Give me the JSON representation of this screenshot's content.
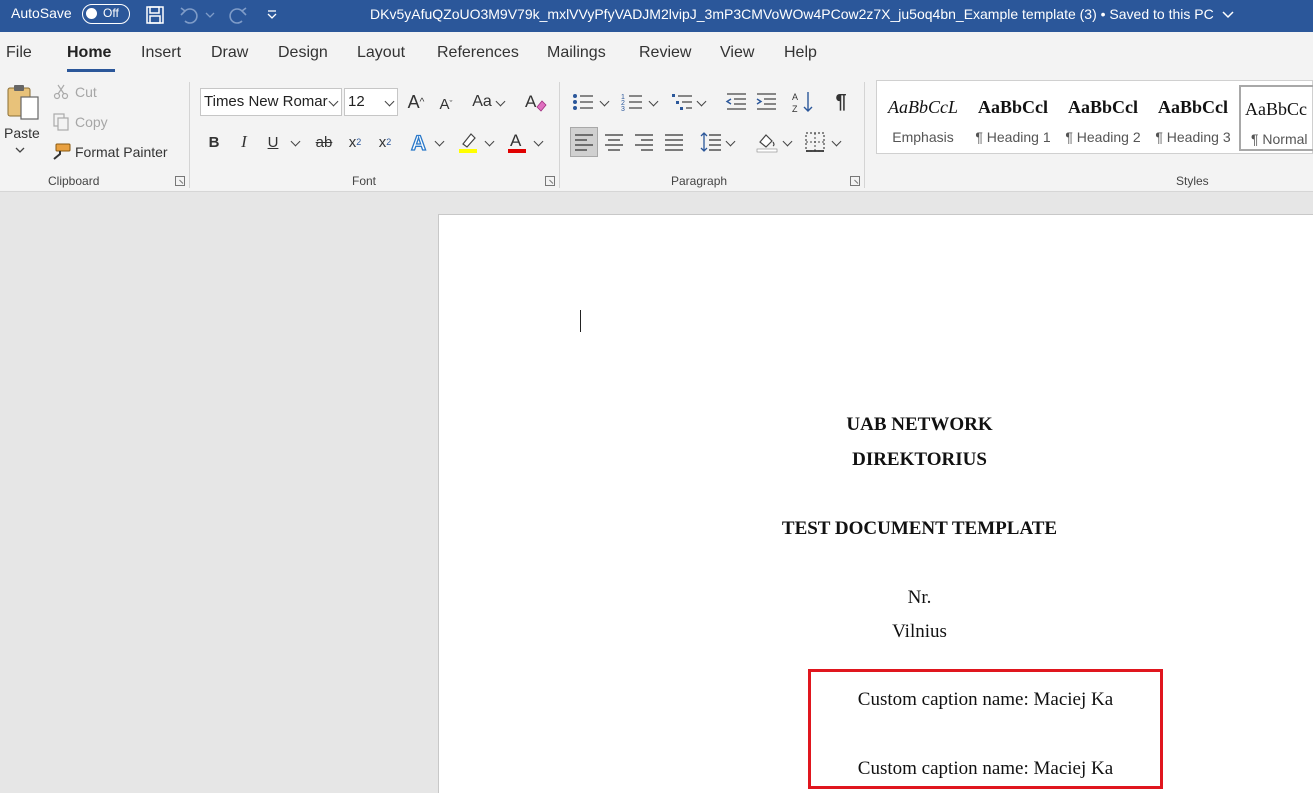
{
  "titlebar": {
    "autosave_label": "AutoSave",
    "autosave_state": "Off",
    "document_title": "DKv5yAfuQZoUO3M9V79k_mxlVVyPfyVADJM2lvipJ_3mP3CMVoWOw4PCow2z7X_ju5oq4bn_Example template (3) • Saved to this PC"
  },
  "tabs": [
    "File",
    "Home",
    "Insert",
    "Draw",
    "Design",
    "Layout",
    "References",
    "Mailings",
    "Review",
    "View",
    "Help"
  ],
  "active_tab": "Home",
  "clipboard": {
    "paste_label": "Paste",
    "cut_label": "Cut",
    "copy_label": "Copy",
    "format_painter_label": "Format Painter",
    "group_label": "Clipboard"
  },
  "font": {
    "font_name": "Times New Romar",
    "font_size": "12",
    "change_case_label": "Aa",
    "bold": "B",
    "italic": "I",
    "underline": "U",
    "strikethrough": "ab",
    "group_label": "Font"
  },
  "paragraph": {
    "show_marks": "¶",
    "group_label": "Paragraph"
  },
  "styles": {
    "items": [
      {
        "preview": "AaBbCcL",
        "name": "Emphasis"
      },
      {
        "preview": "AaBbCcl",
        "name": "¶ Heading 1"
      },
      {
        "preview": "AaBbCcl",
        "name": "¶ Heading 2"
      },
      {
        "preview": "AaBbCcl",
        "name": "¶ Heading 3"
      },
      {
        "preview": "AaBbCc",
        "name": "¶ Normal"
      }
    ],
    "group_label": "Styles"
  },
  "document": {
    "company": "UAB  NETWORK",
    "department": "DIREKTORIUS",
    "heading": "TEST DOCUMENT TEMPLATE",
    "number": "Nr.",
    "city": "Vilnius",
    "caption_1": "Custom caption name: Maciej Ka",
    "caption_2": "Custom caption name: Maciej Ka"
  },
  "colors": {
    "titlebar": "#2b579a",
    "highlight_box": "#e0161e",
    "highlighter": "#ffff00",
    "font_color": "#e00000"
  }
}
